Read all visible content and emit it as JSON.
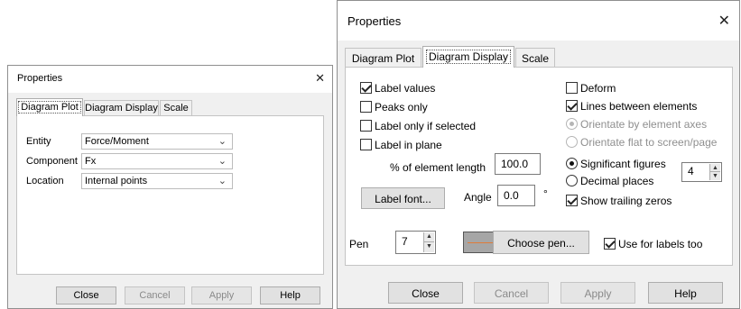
{
  "left_dialog": {
    "title": "Properties",
    "close_glyph": "✕",
    "tabs": [
      "Diagram Plot",
      "Diagram Display",
      "Scale"
    ],
    "active_tab": 0,
    "fields": [
      {
        "label": "Entity",
        "value": "Force/Moment"
      },
      {
        "label": "Component",
        "value": "Fx"
      },
      {
        "label": "Location",
        "value": "Internal points"
      }
    ],
    "buttons": {
      "close": "Close",
      "cancel": "Cancel",
      "apply": "Apply",
      "help": "Help"
    }
  },
  "right_dialog": {
    "title": "Properties",
    "close_glyph": "✕",
    "tabs": [
      "Diagram Plot",
      "Diagram Display",
      "Scale"
    ],
    "active_tab": 1,
    "left_checks": [
      {
        "label": "Label values",
        "checked": true
      },
      {
        "label": "Peaks only",
        "checked": false
      },
      {
        "label": "Label only if selected",
        "checked": false
      },
      {
        "label": "Label in plane",
        "checked": false
      }
    ],
    "element_length_label": "% of element length",
    "element_length_value": "100.0",
    "label_font_button": "Label font...",
    "angle_label": "Angle",
    "angle_value": "0.0",
    "degree_symbol": "°",
    "right_checks": [
      {
        "label": "Deform",
        "checked": false
      },
      {
        "label": "Lines between elements",
        "checked": true
      }
    ],
    "orient_radios": [
      {
        "label": "Orientate by element axes",
        "checked": true
      },
      {
        "label": "Orientate flat to screen/page",
        "checked": false
      }
    ],
    "precision_radios": [
      {
        "label": "Significant figures",
        "checked": true
      },
      {
        "label": "Decimal places",
        "checked": false
      }
    ],
    "precision_value": "4",
    "show_trailing_zeros": {
      "label": "Show trailing zeros",
      "checked": true
    },
    "pen_label": "Pen",
    "pen_value": "7",
    "pen_color": "#e07b39",
    "choose_pen_button": "Choose pen...",
    "use_for_labels": {
      "label": "Use for labels too",
      "checked": true
    },
    "buttons": {
      "close": "Close",
      "cancel": "Cancel",
      "apply": "Apply",
      "help": "Help"
    }
  }
}
